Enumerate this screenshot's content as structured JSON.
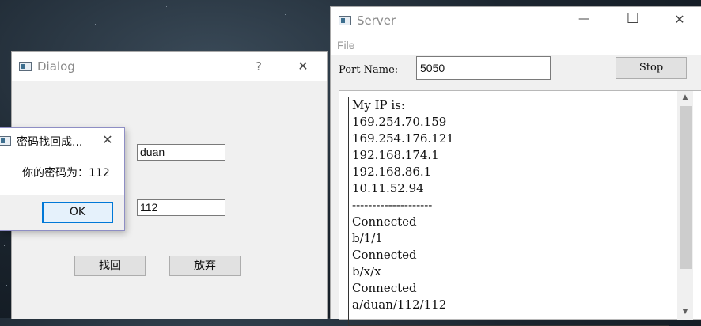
{
  "server": {
    "title": "Server",
    "menu_file": "File",
    "port_label": "Port Name:",
    "port_value": "5050",
    "stop_label": "Stop",
    "log_lines": [
      "My IP is:",
      "169.254.70.159",
      "169.254.176.121",
      "192.168.174.1",
      "192.168.86.1",
      "10.11.52.94",
      "--------------------",
      "Connected",
      "b/1/1",
      "Connected",
      "b/x/x",
      "Connected",
      "a/duan/112/112"
    ],
    "minimize_glyph": "—",
    "maximize_glyph": "☐",
    "close_glyph": "✕"
  },
  "dialog": {
    "title": "Dialog",
    "help_glyph": "?",
    "close_glyph": "✕",
    "username_value": "duan",
    "answer_value": "112",
    "retrieve_label": "找回",
    "abandon_label": "放弃"
  },
  "msgbox": {
    "title": "密码找回成...",
    "close_glyph": "✕",
    "message": "你的密码为：112",
    "ok_label": "OK"
  },
  "icons": {
    "app_icon": "window-app-icon"
  }
}
